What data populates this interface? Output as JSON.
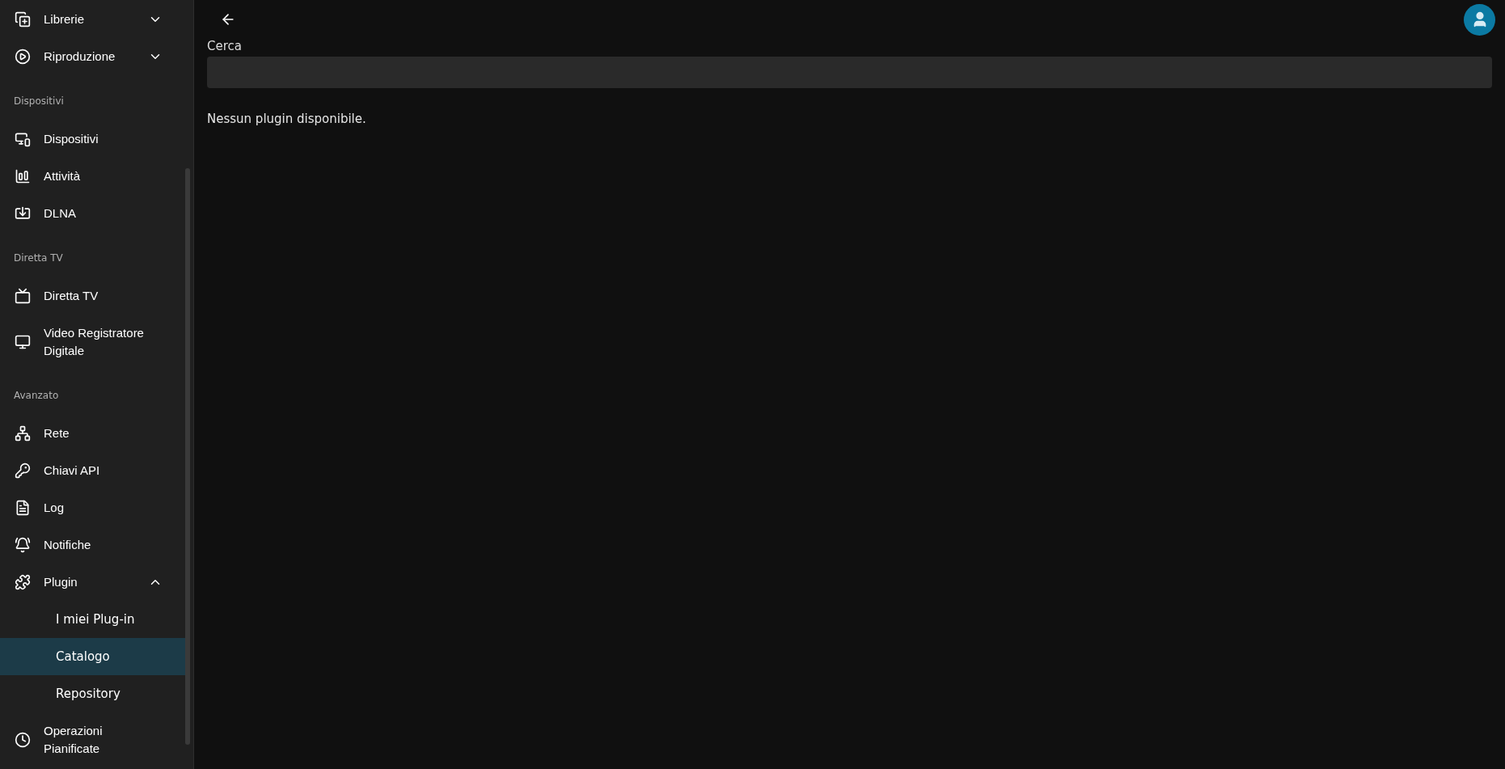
{
  "sidebar": {
    "sections": [
      {
        "items": [
          {
            "label": "Librerie",
            "selected": false,
            "expanded": false
          },
          {
            "label": "Riproduzione",
            "selected": false,
            "expanded": false
          }
        ]
      },
      {
        "header": "Dispositivi",
        "items": [
          {
            "label": "Dispositivi",
            "selected": false
          },
          {
            "label": "Attività",
            "selected": false
          },
          {
            "label": "DLNA",
            "selected": false
          }
        ]
      },
      {
        "header": "Diretta TV",
        "items": [
          {
            "label": "Diretta TV",
            "selected": false
          },
          {
            "label": "Video Registratore Digitale",
            "selected": false
          }
        ]
      },
      {
        "header": "Avanzato",
        "items": [
          {
            "label": "Rete",
            "selected": false
          },
          {
            "label": "Chiavi API",
            "selected": false
          },
          {
            "label": "Log",
            "selected": false
          },
          {
            "label": "Notifiche",
            "selected": false
          },
          {
            "label": "Plugin",
            "selected": false,
            "expanded": true,
            "children": [
              {
                "label": "I miei Plug-in",
                "selected": false
              },
              {
                "label": "Catalogo",
                "selected": true
              },
              {
                "label": "Repository",
                "selected": false
              }
            ]
          },
          {
            "label": "Operazioni Pianificate",
            "selected": false
          }
        ]
      }
    ]
  },
  "main": {
    "search": {
      "label": "Cerca"
    },
    "message": "Nessun plugin disponibile."
  }
}
